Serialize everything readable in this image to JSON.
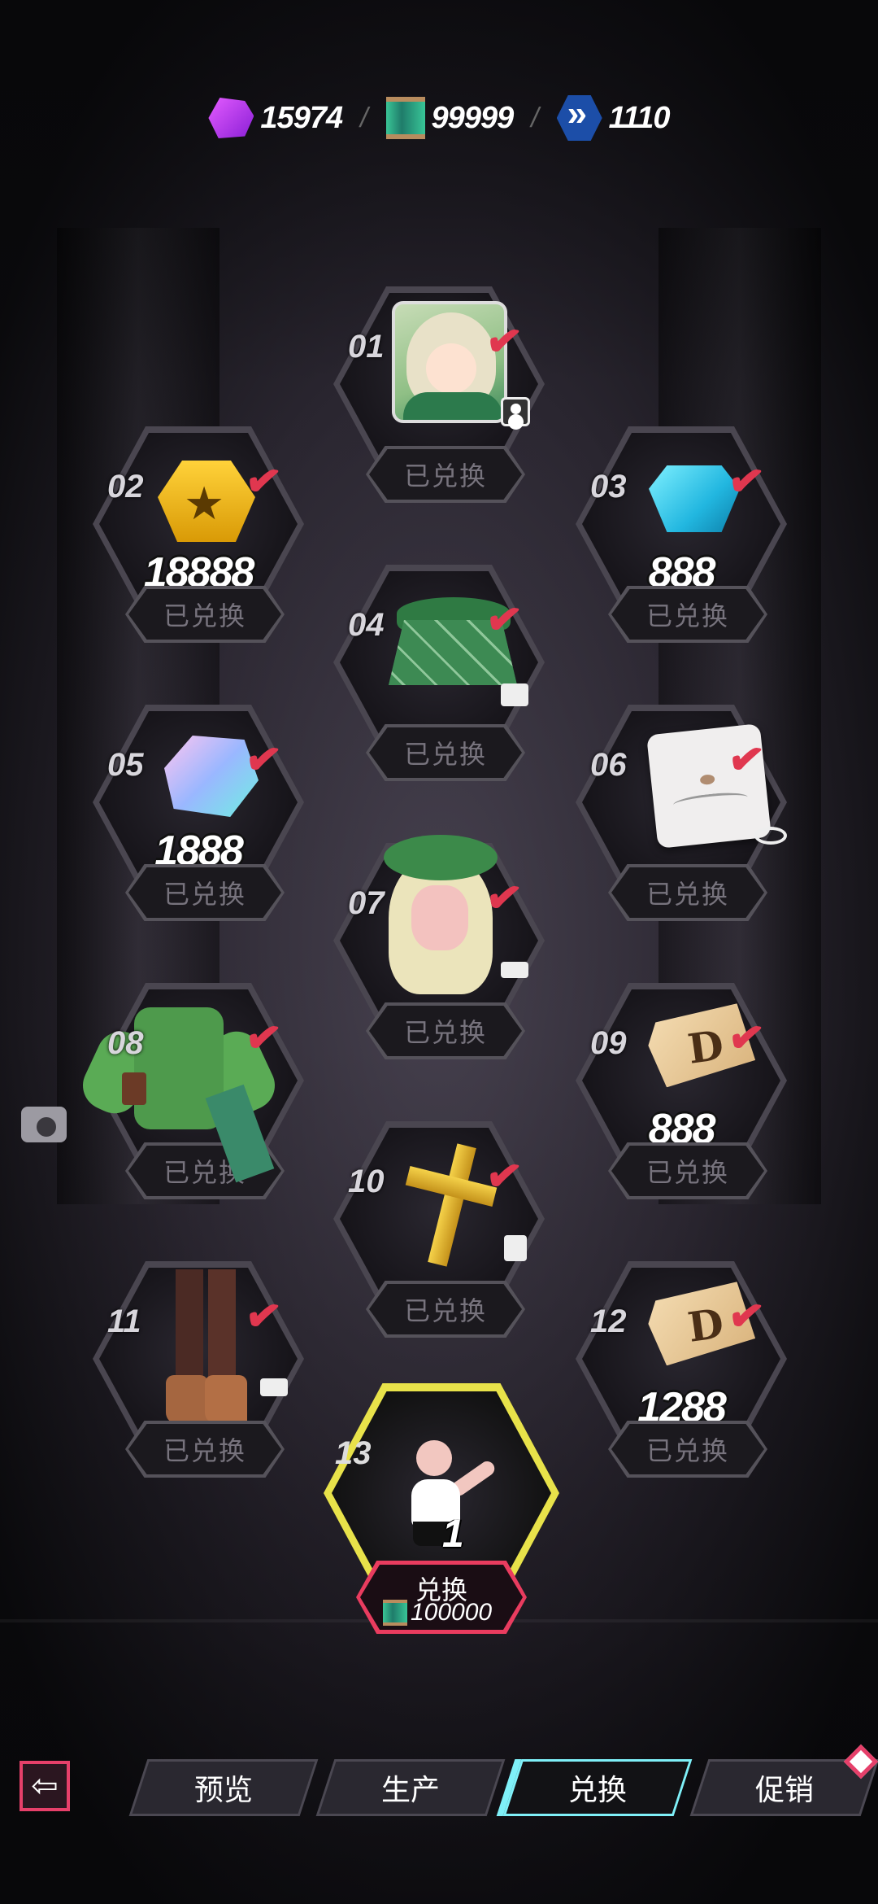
{
  "currencies": [
    {
      "icon": "purple-gem-icon",
      "value": "15974"
    },
    {
      "icon": "green-ticket-icon",
      "value": "99999"
    },
    {
      "icon": "blue-chevron-icon",
      "value": "1110"
    }
  ],
  "separator": "/",
  "redeemed_label": "已兑换",
  "check_mark": "✔",
  "slots": [
    {
      "num": "01",
      "item": "character-avatar"
    },
    {
      "num": "02",
      "item": "gold-star-token",
      "amount": "18888"
    },
    {
      "num": "03",
      "item": "blue-crystal",
      "amount": "888"
    },
    {
      "num": "04",
      "item": "green-plaid-skirt"
    },
    {
      "num": "05",
      "item": "pastel-gem",
      "amount": "1888"
    },
    {
      "num": "06",
      "item": "face-makeup-card"
    },
    {
      "num": "07",
      "item": "beret-hairstyle"
    },
    {
      "num": "08",
      "item": "green-jacket-outfit"
    },
    {
      "num": "09",
      "item": "d-tag",
      "amount": "888"
    },
    {
      "num": "10",
      "item": "gold-cross"
    },
    {
      "num": "11",
      "item": "brown-boots"
    },
    {
      "num": "12",
      "item": "d-tag",
      "amount": "1288"
    }
  ],
  "slot13": {
    "num": "13",
    "pose_count": "1",
    "button_label": "兑换",
    "price": "100000"
  },
  "tabs": [
    {
      "label": "预览",
      "active": false
    },
    {
      "label": "生产",
      "active": false
    },
    {
      "label": "兑换",
      "active": true
    },
    {
      "label": "促销",
      "active": false
    }
  ],
  "colors": {
    "accent_pink": "#e6406a",
    "active_tab": "#7ff0f8",
    "highlight_yellow": "#e8e24a",
    "check_red": "#e0374f"
  }
}
